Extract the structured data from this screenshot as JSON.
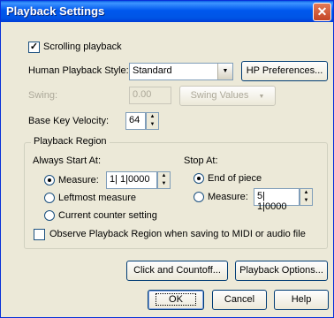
{
  "window": {
    "title": "Playback Settings",
    "close_glyph": "✕"
  },
  "scrolling_playback": {
    "label": "Scrolling playback",
    "checked": true
  },
  "human_playback": {
    "label": "Human Playback Style:",
    "value": "Standard",
    "preferences_button": "HP Preferences..."
  },
  "swing": {
    "label": "Swing:",
    "value": "0.00",
    "values_button": "Swing Values"
  },
  "base_key_velocity": {
    "label": "Base Key Velocity:",
    "value": "64"
  },
  "playback_region": {
    "legend": "Playback Region",
    "always_start_at": {
      "label": "Always Start At:",
      "measure_label": "Measure:",
      "measure_value": "1| 1|0000",
      "leftmost_label": "Leftmost measure",
      "current_counter_label": "Current counter setting",
      "selected": "measure"
    },
    "stop_at": {
      "label": "Stop At:",
      "end_of_piece_label": "End of piece",
      "measure_label": "Measure:",
      "measure_value": "5| 1|0000",
      "selected": "end_of_piece"
    },
    "observe_label": "Observe Playback Region when saving to MIDI or audio file",
    "observe_checked": false
  },
  "buttons": {
    "click_countoff": "Click and Countoff...",
    "playback_options": "Playback Options...",
    "ok": "OK",
    "cancel": "Cancel",
    "help": "Help"
  }
}
